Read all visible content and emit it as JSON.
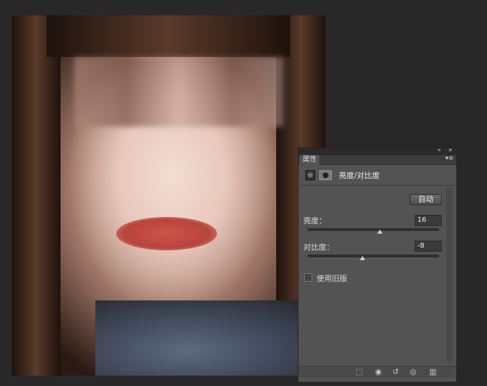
{
  "panel": {
    "tab": "属性",
    "title": "亮度/对比度",
    "auto_label": "自动",
    "brightness": {
      "label": "亮度：",
      "value": "16",
      "fraction": 0.55
    },
    "contrast": {
      "label": "对比度：",
      "value": "-8",
      "fraction": 0.42
    },
    "legacy_label": "使用旧版",
    "legacy_checked": false,
    "collapse_icon": "«",
    "close_icon": "×",
    "menu_icon": "▾≡",
    "adjust_icon": "☼"
  }
}
